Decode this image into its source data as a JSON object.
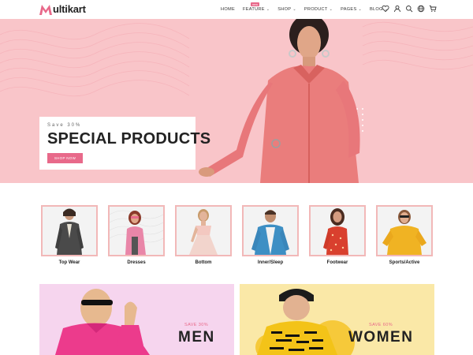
{
  "header": {
    "logo_text": "ultikart",
    "nav": [
      {
        "label": "HOME",
        "caret": false
      },
      {
        "label": "FEATURE",
        "caret": true,
        "badge": "new"
      },
      {
        "label": "SHOP",
        "caret": true
      },
      {
        "label": "PRODUCT",
        "caret": true
      },
      {
        "label": "PAGES",
        "caret": true
      },
      {
        "label": "BLOG",
        "caret": true
      }
    ],
    "icons": [
      "heart-icon",
      "user-icon",
      "search-icon",
      "globe-icon",
      "cart-icon"
    ]
  },
  "hero": {
    "subtitle": "Save 30%",
    "title": "SPECIAL PRODUCTS",
    "button": "SHOP NOW",
    "background": "#f9c5c9"
  },
  "categories": [
    {
      "label": "Top Wear"
    },
    {
      "label": "Dresses"
    },
    {
      "label": "Bottom"
    },
    {
      "label": "Inner/Sleep"
    },
    {
      "label": "Footwear"
    },
    {
      "label": "Sports/Active"
    }
  ],
  "banners": {
    "men": {
      "save": "SAVE 30%",
      "title": "MEN",
      "background": "#f6d5ee"
    },
    "women": {
      "save": "SAVE 60%",
      "title": "WOMEN",
      "background": "#fae8a7"
    }
  },
  "colors": {
    "accent": "#e8698a",
    "frame": "#f2b8b8"
  }
}
